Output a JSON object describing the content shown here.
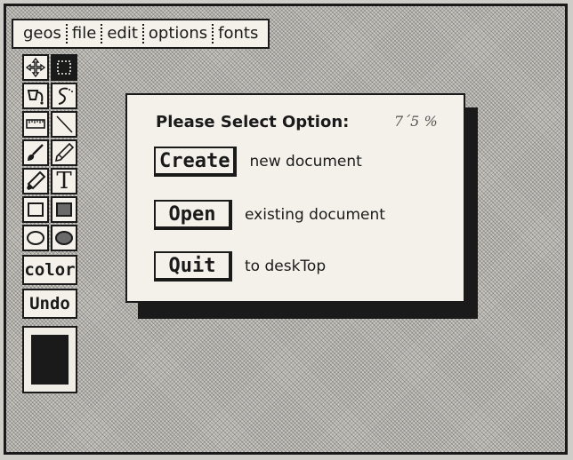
{
  "menubar": {
    "items": [
      "geos",
      "file",
      "edit",
      "options",
      "fonts"
    ]
  },
  "toolbox": {
    "tools": [
      {
        "name": "move-icon"
      },
      {
        "name": "selection-icon",
        "selected": true
      },
      {
        "name": "paint-bucket-icon"
      },
      {
        "name": "lasso-icon"
      },
      {
        "name": "ruler-icon"
      },
      {
        "name": "line-icon"
      },
      {
        "name": "brush-icon"
      },
      {
        "name": "pencil-icon"
      },
      {
        "name": "eraser-icon"
      },
      {
        "name": "text-tool-icon"
      },
      {
        "name": "rectangle-icon"
      },
      {
        "name": "filled-rectangle-icon"
      },
      {
        "name": "ellipse-icon"
      },
      {
        "name": "filled-ellipse-icon"
      }
    ],
    "text_tool_label": "T",
    "color_label": "color",
    "undo_label": "Undo"
  },
  "dialog": {
    "title": "Please Select Option:",
    "note": "7´5 %",
    "options": [
      {
        "button": "Create",
        "description": "new document"
      },
      {
        "button": "Open",
        "description": "existing document"
      },
      {
        "button": "Quit",
        "description": "to deskTop"
      }
    ]
  },
  "colors": {
    "ink": "#1a1a1a",
    "paper": "#f3f1ea",
    "desktop_pattern": "#c9c7c1"
  }
}
